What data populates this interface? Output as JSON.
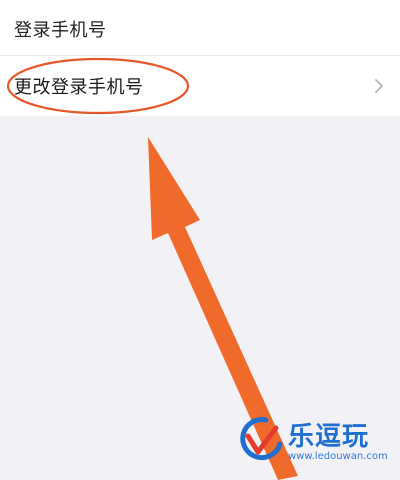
{
  "settings": {
    "login_phone_label": "登录手机号",
    "change_login_phone_label": "更改登录手机号"
  },
  "icons": {
    "chevron": "chevron-right-icon"
  },
  "annotation": {
    "highlight_color": "#e4582a",
    "arrow_color": "#f06a2c"
  },
  "watermark": {
    "brand_name": "乐逗玩",
    "url": "www.ledouwan.com",
    "brand_color": "#1f6fd1",
    "logo_accent_color": "#e53b2c"
  }
}
